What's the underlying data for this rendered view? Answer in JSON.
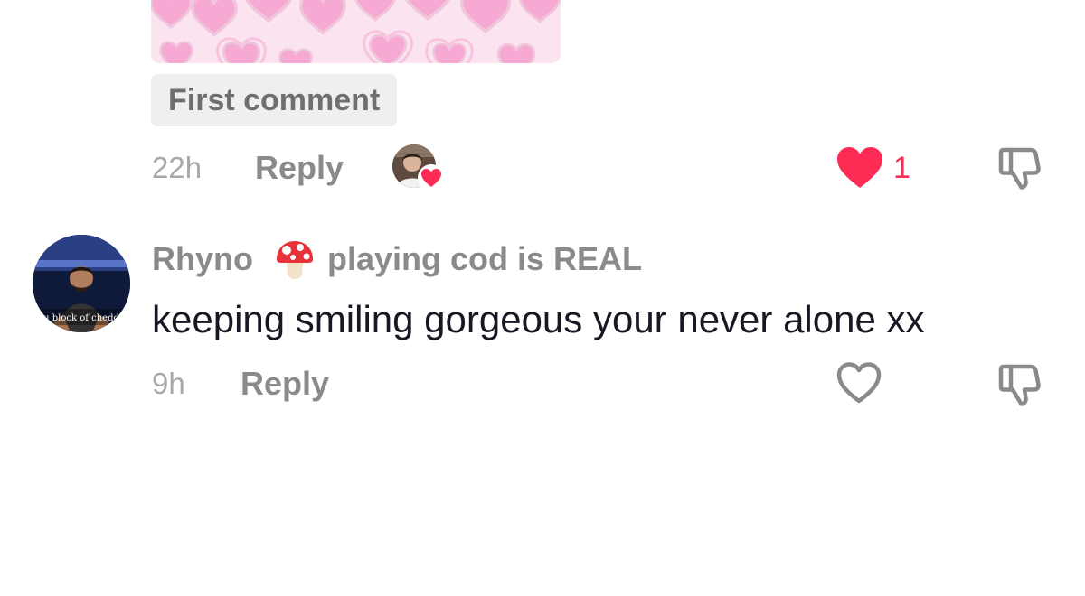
{
  "comment_1": {
    "chip_label": "First comment",
    "time": "22h",
    "reply_label": "Reply",
    "like_count": "1",
    "liked": true,
    "creator_liked": true,
    "icons": {
      "creator_avatar": "creator-avatar",
      "like": "heart-filled-icon",
      "dislike": "thumbs-down-icon"
    }
  },
  "comment_2": {
    "username": "Rhyno",
    "badge_emoji": "mushroom-icon",
    "subtitle": "playing cod is REAL",
    "text": "keeping smiling gorgeous your never alone xx",
    "avatar_caption": "u block of chedd",
    "time": "9h",
    "reply_label": "Reply",
    "liked": false,
    "icons": {
      "like": "heart-outline-icon",
      "dislike": "thumbs-down-icon"
    }
  },
  "colors": {
    "like_red": "#fe2c55",
    "muted_text": "#8a8a8a",
    "light_text": "#a8a8a8",
    "body_text": "#161823",
    "chip_bg": "#efefef",
    "image_bg": "#fbe4f0"
  }
}
